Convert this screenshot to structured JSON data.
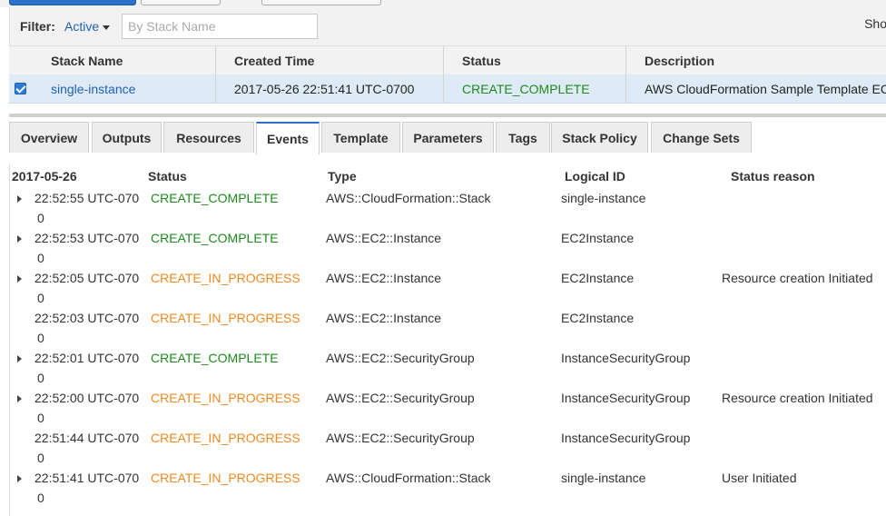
{
  "filter": {
    "label": "Filter:",
    "value": "Active",
    "search_placeholder": "By Stack Name",
    "show_label": "Sho"
  },
  "stacks": {
    "headers": [
      "Stack Name",
      "Created Time",
      "Status",
      "Description"
    ],
    "row": {
      "name": "single-instance",
      "created": "2017-05-26 22:51:41 UTC-0700",
      "status": "CREATE_COMPLETE",
      "description": "AWS CloudFormation Sample Template EC"
    }
  },
  "tabs": [
    "Overview",
    "Outputs",
    "Resources",
    "Events",
    "Template",
    "Parameters",
    "Tags",
    "Stack Policy",
    "Change Sets"
  ],
  "active_tab": "Events",
  "events": {
    "headers": {
      "date": "2017-05-26",
      "status": "Status",
      "type": "Type",
      "logical_id": "Logical ID",
      "reason": "Status reason"
    },
    "rows": [
      {
        "time": "22:52:55 UTC-070",
        "time2": "0",
        "status": "CREATE_COMPLETE",
        "type": "AWS::CloudFormation::Stack",
        "logical_id": "single-instance",
        "reason": "",
        "expandable": true
      },
      {
        "time": "22:52:53 UTC-070",
        "time2": "0",
        "status": "CREATE_COMPLETE",
        "type": "AWS::EC2::Instance",
        "logical_id": "EC2Instance",
        "reason": "",
        "expandable": true
      },
      {
        "time": "22:52:05 UTC-070",
        "time2": "0",
        "status": "CREATE_IN_PROGRESS",
        "type": "AWS::EC2::Instance",
        "logical_id": "EC2Instance",
        "reason": "Resource creation Initiated",
        "expandable": true
      },
      {
        "time": "22:52:03 UTC-070",
        "time2": "0",
        "status": "CREATE_IN_PROGRESS",
        "type": "AWS::EC2::Instance",
        "logical_id": "EC2Instance",
        "reason": "",
        "expandable": false
      },
      {
        "time": "22:52:01 UTC-070",
        "time2": "0",
        "status": "CREATE_COMPLETE",
        "type": "AWS::EC2::SecurityGroup",
        "logical_id": "InstanceSecurityGroup",
        "reason": "",
        "expandable": true
      },
      {
        "time": "22:52:00 UTC-070",
        "time2": "0",
        "status": "CREATE_IN_PROGRESS",
        "type": "AWS::EC2::SecurityGroup",
        "logical_id": "InstanceSecurityGroup",
        "reason": "Resource creation Initiated",
        "expandable": true
      },
      {
        "time": "22:51:44 UTC-070",
        "time2": "0",
        "status": "CREATE_IN_PROGRESS",
        "type": "AWS::EC2::SecurityGroup",
        "logical_id": "InstanceSecurityGroup",
        "reason": "",
        "expandable": false
      },
      {
        "time": "22:51:41 UTC-070",
        "time2": "0",
        "status": "CREATE_IN_PROGRESS",
        "type": "AWS::CloudFormation::Stack",
        "logical_id": "single-instance",
        "reason": "User Initiated",
        "expandable": true
      }
    ]
  },
  "colors": {
    "complete": "#1d8a1d",
    "in_progress": "#ef8a20",
    "link": "#2161b3",
    "accent": "#2b70c9"
  }
}
